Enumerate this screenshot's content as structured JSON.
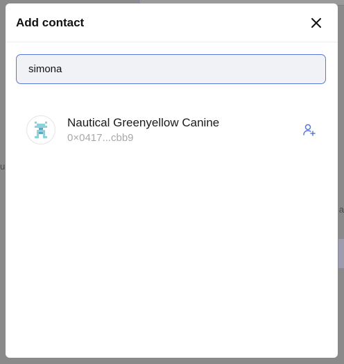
{
  "modal": {
    "title": "Add contact",
    "close_icon": "close-icon"
  },
  "search": {
    "value": "simona",
    "placeholder": ""
  },
  "results": [
    {
      "name": "Nautical Greenyellow Canine",
      "address": "0×0417...cbb9",
      "avatar_icon": "identicon",
      "action_icon": "add-user-icon"
    }
  ],
  "colors": {
    "accent": "#5876d8",
    "input_bg": "#f0f2f5",
    "identicon": "#8fd0dc",
    "overlay": "#8a8a8a"
  }
}
